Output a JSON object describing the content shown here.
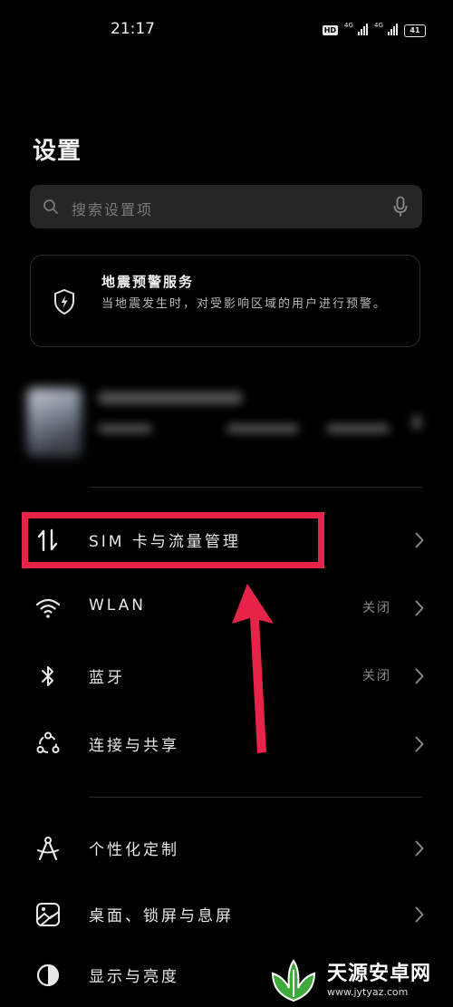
{
  "status_bar": {
    "time": "21:17",
    "hd_label": "HD",
    "net1": "4G",
    "net2": "4G",
    "battery": "41"
  },
  "page_title": "设置",
  "search": {
    "placeholder": "搜索设置项"
  },
  "alert_card": {
    "title": "地震预警服务",
    "description": "当地震发生时，对受影响区域的用户进行预警。"
  },
  "items": [
    {
      "label": "SIM 卡与流量管理",
      "status": "",
      "icon": "data-transfer-icon"
    },
    {
      "label": "WLAN",
      "status": "关闭",
      "icon": "wifi-icon"
    },
    {
      "label": "蓝牙",
      "status": "关闭",
      "icon": "bluetooth-icon"
    },
    {
      "label": "连接与共享",
      "status": "",
      "icon": "share-connections-icon"
    },
    {
      "label": "个性化定制",
      "status": "",
      "icon": "compass-icon"
    },
    {
      "label": "桌面、锁屏与息屏",
      "status": "",
      "icon": "wallpaper-icon"
    },
    {
      "label": "显示与亮度",
      "status": "",
      "icon": "brightness-icon"
    }
  ],
  "watermark": {
    "name": "天源安卓网",
    "url": "www.jytyaz.com"
  },
  "colors": {
    "background": "#000000",
    "annotation": "#e8234a",
    "watermark_green": "#3daa3a"
  }
}
